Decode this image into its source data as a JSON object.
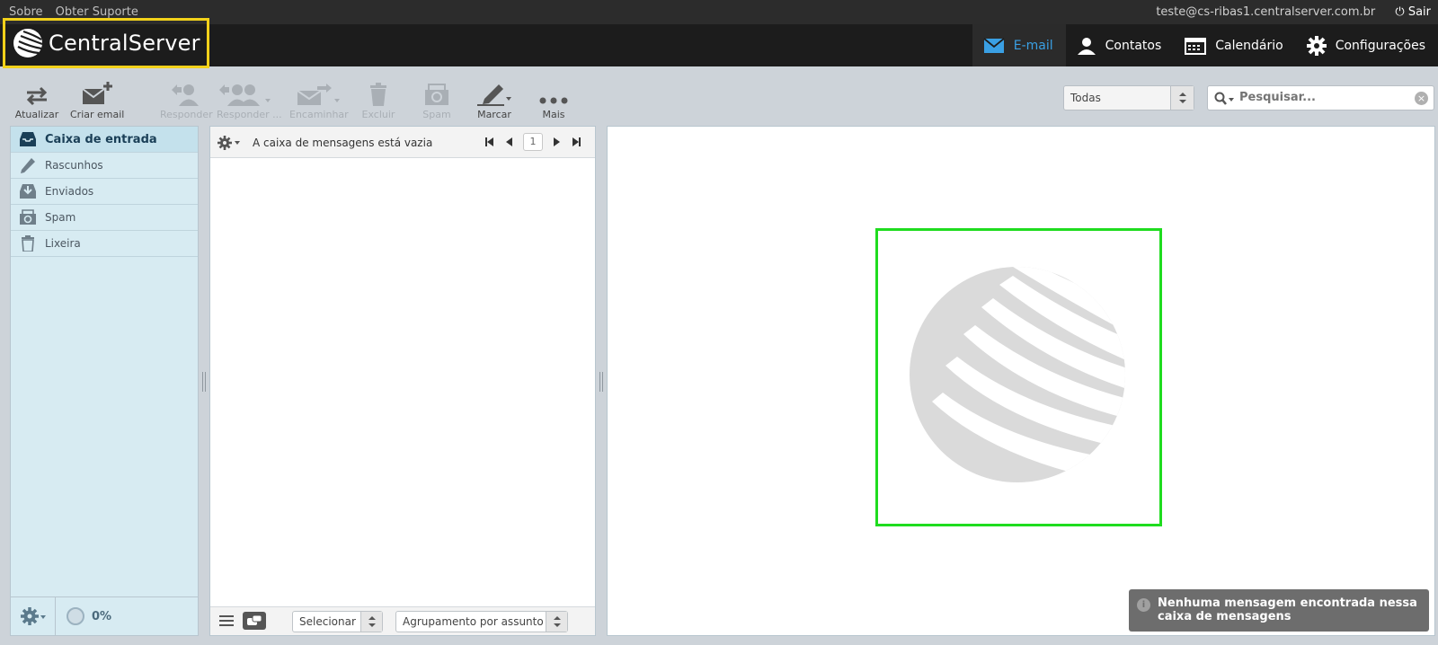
{
  "topbar": {
    "links": [
      "Sobre",
      "Obter Suporte"
    ],
    "user_email": "teste@cs-ribas1.centralserver.com.br",
    "logout_label": "Sair"
  },
  "header": {
    "logo_text": "CentralServer",
    "tasks": [
      {
        "label": "E-mail",
        "icon": "envelope-icon",
        "active": true
      },
      {
        "label": "Contatos",
        "icon": "person-icon",
        "active": false
      },
      {
        "label": "Calendário",
        "icon": "calendar-icon",
        "active": false
      },
      {
        "label": "Configurações",
        "icon": "gear-icon",
        "active": false
      }
    ]
  },
  "toolbar": {
    "buttons": [
      {
        "label": "Atualizar",
        "icon": "refresh-arrows-icon",
        "enabled": true
      },
      {
        "label": "Criar email",
        "icon": "compose-icon",
        "enabled": true
      },
      {
        "label": "Responder",
        "icon": "reply-icon",
        "enabled": false
      },
      {
        "label": "Responder ...",
        "icon": "reply-all-icon",
        "enabled": false
      },
      {
        "label": "Encaminhar",
        "icon": "forward-icon",
        "enabled": false
      },
      {
        "label": "Excluir",
        "icon": "trash-icon",
        "enabled": false
      },
      {
        "label": "Spam",
        "icon": "spam-icon",
        "enabled": false
      },
      {
        "label": "Marcar",
        "icon": "marker-icon",
        "enabled": true
      },
      {
        "label": "Mais",
        "icon": "more-dots-icon",
        "enabled": true
      }
    ],
    "filter_value": "Todas",
    "search_placeholder": "Pesquisar..."
  },
  "folders": {
    "items": [
      {
        "label": "Caixa de entrada",
        "icon": "inbox-icon",
        "selected": true
      },
      {
        "label": "Rascunhos",
        "icon": "pencil-icon",
        "selected": false
      },
      {
        "label": "Enviados",
        "icon": "sent-icon",
        "selected": false
      },
      {
        "label": "Spam",
        "icon": "spam-folder-icon",
        "selected": false
      },
      {
        "label": "Lixeira",
        "icon": "trash-icon",
        "selected": false
      }
    ],
    "quota": "0%"
  },
  "message_list": {
    "empty_text": "A caixa de mensagens está vazia",
    "page_number": "1",
    "select_label": "Selecionar",
    "threading_label": "Agrupamento por assunto"
  },
  "preview": {
    "toast": "Nenhuma mensagem encontrada nessa caixa de mensagens"
  },
  "colors": {
    "accent": "#3aa0e4",
    "highlight_yellow": "#f2d11a",
    "highlight_green": "#1fdc1f",
    "header_bg": "#1c1c1c"
  }
}
